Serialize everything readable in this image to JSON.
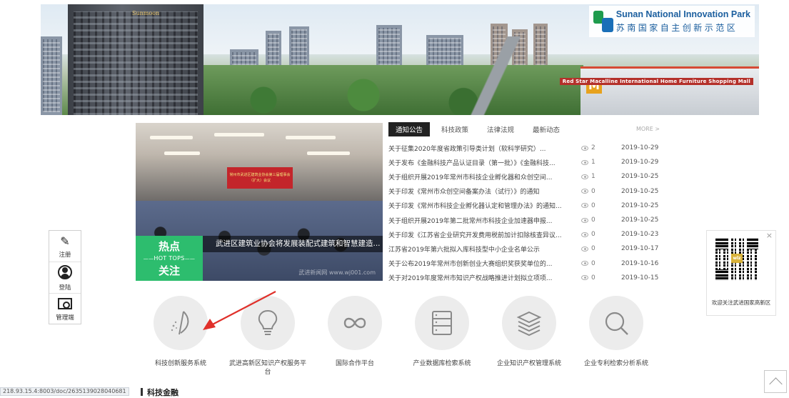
{
  "banner": {
    "park_name_en": "Sunan National Innovation Park",
    "park_name_cn": "苏南国家自主创新示范区",
    "tower_sign": "Sunmoon",
    "mall_sign": "Red Star Macalline International Home Furniture Shopping Mall"
  },
  "hot": {
    "label_cn": "热点",
    "label_en": "HOT TOPS",
    "label_follow": "关注",
    "caption": "武进区建筑业协会将发展装配式建筑和智慧建造...",
    "watermark": "武进新闻网 www.wj001.com",
    "stage_banner": "常州市武进区建筑业协会第三届理事会（扩大）会议"
  },
  "news": {
    "tabs": [
      {
        "label": "通知公告"
      },
      {
        "label": "科技政策"
      },
      {
        "label": "法律法规"
      },
      {
        "label": "最新动态"
      }
    ],
    "more_label": "MORE >",
    "items": [
      {
        "title": "关于征集2020年度省政策引导类计划（软科学研究）...",
        "views": "2",
        "date": "2019-10-29"
      },
      {
        "title": "关于发布《金融科技产品认证目录（第一批）》《金融科技...",
        "views": "1",
        "date": "2019-10-29"
      },
      {
        "title": "关于组织开展2019年常州市科技企业孵化器和众创空间...",
        "views": "1",
        "date": "2019-10-25"
      },
      {
        "title": "关于印发《常州市众创空间备案办法（试行）》的通知",
        "views": "0",
        "date": "2019-10-25"
      },
      {
        "title": "关于印发《常州市科技企业孵化器认定和管理办法》的通知...",
        "views": "0",
        "date": "2019-10-25"
      },
      {
        "title": "关于组织开展2019年第二批常州市科技企业加速器申报...",
        "views": "0",
        "date": "2019-10-25"
      },
      {
        "title": "关于印发《江苏省企业研究开发费用税前加计扣除核查异议...",
        "views": "0",
        "date": "2019-10-23"
      },
      {
        "title": "江苏省2019年第六批拟入库科技型中小企业名单公示",
        "views": "0",
        "date": "2019-10-17"
      },
      {
        "title": "关于公布2019年常州市创新创业大赛组织奖获奖单位的...",
        "views": "0",
        "date": "2019-10-16"
      },
      {
        "title": "关于对2019年度常州市知识产权战略推进计划拟立项项...",
        "views": "0",
        "date": "2019-10-15"
      }
    ]
  },
  "side": {
    "register_label": "注册",
    "login_label": "登陆",
    "admin_label": "管理端",
    "register_glyph": "✎"
  },
  "qr": {
    "close": "×",
    "logo": "wlz",
    "caption": "欢迎关注武进国家高新区"
  },
  "platforms": [
    {
      "label": "科技创新服务系统",
      "icon": "tech-innovation-icon"
    },
    {
      "label": "武进高新区知识产权服务平台",
      "icon": "lightbulb-icon"
    },
    {
      "label": "国际合作平台",
      "icon": "infinity-icon"
    },
    {
      "label": "产业数据库检索系统",
      "icon": "database-icon"
    },
    {
      "label": "企业知识产权管理系统",
      "icon": "stack-icon"
    },
    {
      "label": "企业专利检索分析系统",
      "icon": "magnifier-icon"
    }
  ],
  "footer": {
    "status_url": "218.93.15.4:8003/doc/2635139028040681",
    "section_title": "科技金融"
  },
  "colors": {
    "hot_green": "#2dbd6e",
    "arrow_red": "#e0302a",
    "park_blue": "#1b5e9e"
  }
}
